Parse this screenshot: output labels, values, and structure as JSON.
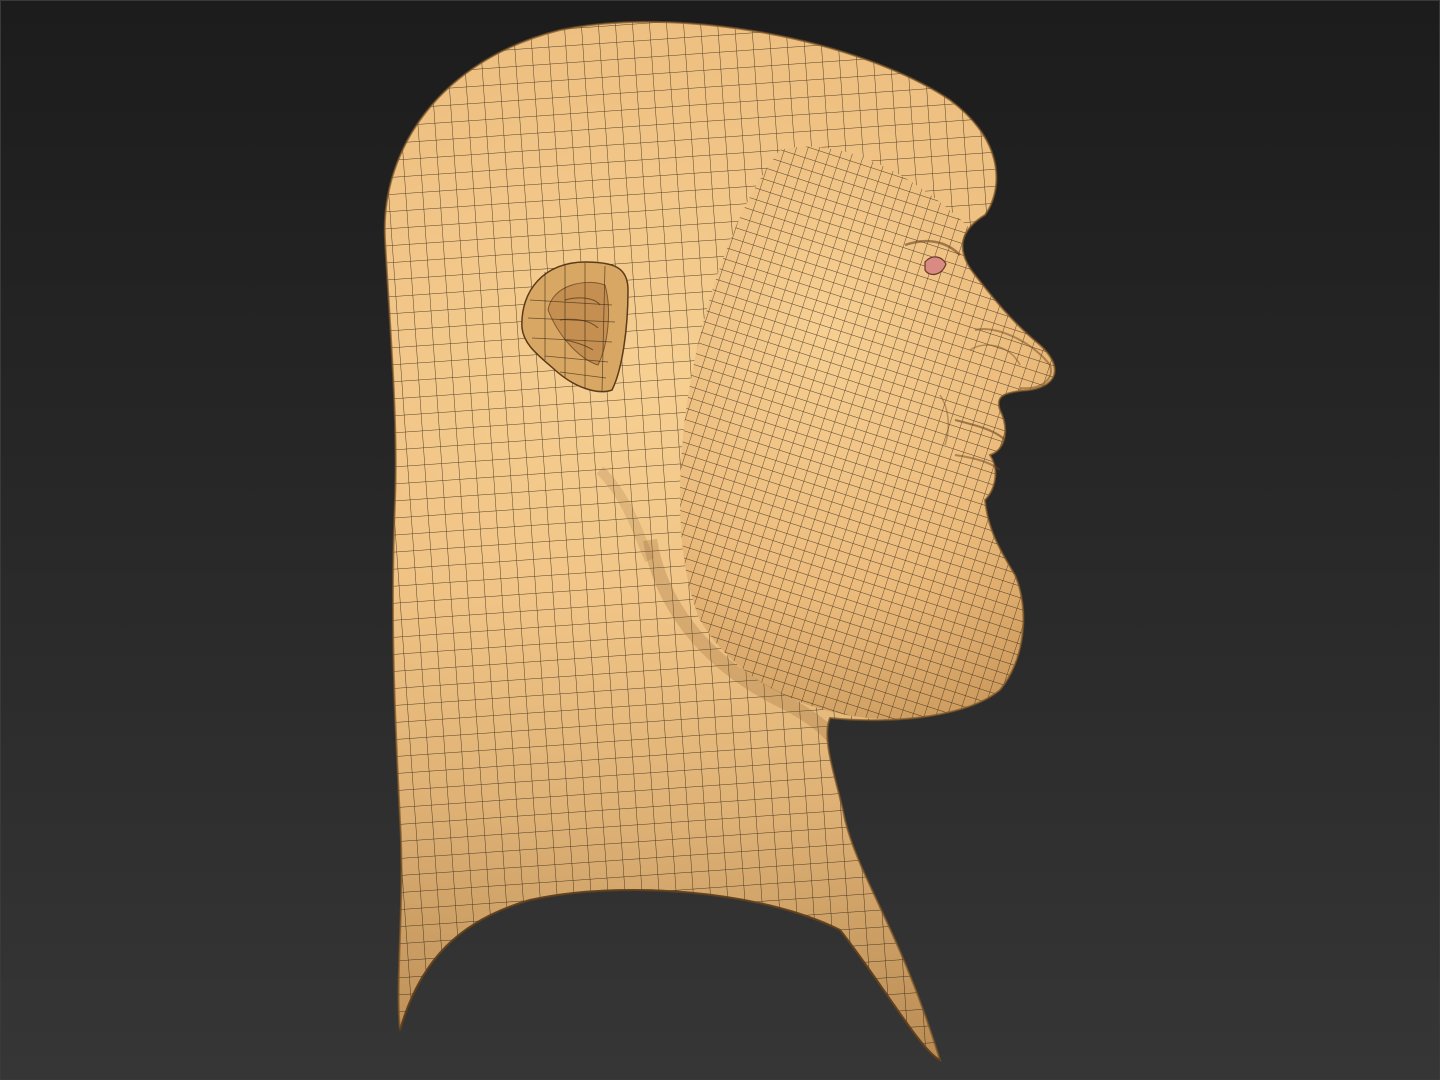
{
  "viewport": {
    "name": "3d-sculpt-viewport",
    "background_top": "#1c1c1c",
    "background_bottom": "#363636"
  },
  "model": {
    "subject": "head-bust-side-profile",
    "display_mode": "polyframe-wireframe-overlay",
    "surface_color": "#e8b877",
    "wire_color": "#3a2a18",
    "eye_color": "#d98a82"
  }
}
